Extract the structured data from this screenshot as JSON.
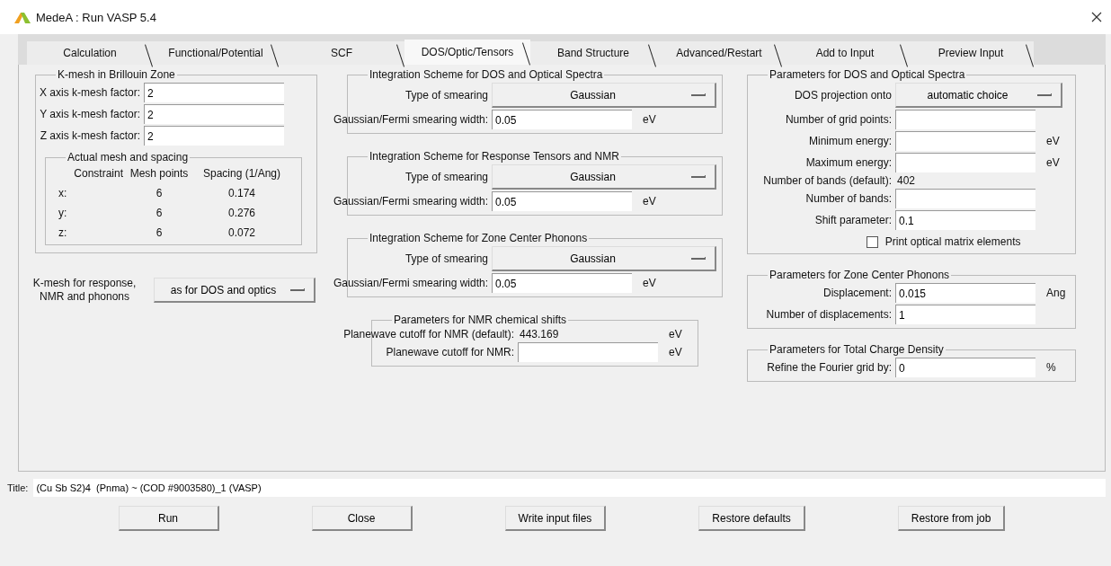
{
  "window": {
    "title": "MedeA : Run VASP 5.4"
  },
  "tabs": [
    {
      "label": "Calculation",
      "selected": false
    },
    {
      "label": "Functional/Potential",
      "selected": false
    },
    {
      "label": "SCF",
      "selected": false
    },
    {
      "label": "DOS/Optic/Tensors",
      "selected": true
    },
    {
      "label": "Band Structure",
      "selected": false
    },
    {
      "label": "Advanced/Restart",
      "selected": false
    },
    {
      "label": "Add to Input",
      "selected": false
    },
    {
      "label": "Preview Input",
      "selected": false
    }
  ],
  "kmesh": {
    "title": "K-mesh in Brillouin Zone",
    "fields": [
      {
        "label": "X axis k-mesh factor:",
        "value": "2"
      },
      {
        "label": "Y axis k-mesh factor:",
        "value": "2"
      },
      {
        "label": "Z axis k-mesh factor:",
        "value": "2"
      }
    ],
    "actual_mesh": {
      "title": "Actual mesh and spacing",
      "columns": [
        "Constraint",
        "Mesh points",
        "Spacing (1/Ang)"
      ],
      "rows": [
        [
          "x:",
          "6",
          "0.174"
        ],
        [
          "y:",
          "6",
          "0.276"
        ],
        [
          "z:",
          "6",
          "0.072"
        ]
      ]
    }
  },
  "response_kmesh": {
    "label": "K-mesh for response, NMR and phonons",
    "value": "as for DOS and optics"
  },
  "middle_groups": [
    {
      "title": "Integration Scheme for DOS and Optical Spectra",
      "rows": [
        {
          "kind": "dropdown",
          "label": "Type of smearing",
          "value": "Gaussian"
        },
        {
          "kind": "field",
          "label": "Gaussian/Fermi smearing width:",
          "value": "0.05",
          "unit": "eV"
        }
      ]
    },
    {
      "title": "Integration Scheme for Response Tensors and NMR",
      "rows": [
        {
          "kind": "dropdown",
          "label": "Type of smearing",
          "value": "Gaussian"
        },
        {
          "kind": "field",
          "label": "Gaussian/Fermi smearing width:",
          "value": "0.05",
          "unit": "eV"
        }
      ]
    },
    {
      "title": "Integration Scheme for Zone Center Phonons",
      "rows": [
        {
          "kind": "dropdown",
          "label": "Type of smearing",
          "value": "Gaussian"
        },
        {
          "kind": "field",
          "label": "Gaussian/Fermi smearing width:",
          "value": "0.05",
          "unit": "eV"
        }
      ]
    },
    {
      "title": "Parameters for NMR chemical shifts",
      "rows": [
        {
          "kind": "readout",
          "label": "Planewave cutoff for NMR (default):",
          "value": "443.169",
          "unit": "eV"
        },
        {
          "kind": "field",
          "label": "Planewave cutoff for NMR:",
          "unit": "eV"
        }
      ]
    }
  ],
  "right_groups": [
    {
      "title": "Parameters for DOS and Optical Spectra",
      "rows": [
        {
          "kind": "dropdown",
          "label": "DOS projection onto",
          "value": "automatic choice"
        },
        {
          "kind": "field",
          "label": "Number of grid points:"
        },
        {
          "kind": "field",
          "label": "Minimum energy:",
          "unit": "eV"
        },
        {
          "kind": "field",
          "label": "Maximum energy:",
          "unit": "eV"
        },
        {
          "kind": "readout",
          "label": "Number of bands (default):",
          "value": "402"
        },
        {
          "kind": "field",
          "label": "Number of bands:"
        },
        {
          "kind": "field",
          "label": "Shift parameter:",
          "value": "0.1"
        },
        {
          "kind": "checkbox",
          "label": "Print optical matrix elements",
          "checked": false
        }
      ]
    },
    {
      "title": "Parameters for Zone Center Phonons",
      "rows": [
        {
          "kind": "field",
          "label": "Displacement:",
          "value": "0.015",
          "unit": "Ang"
        },
        {
          "kind": "field",
          "label": "Number of displacements:",
          "value": "1"
        }
      ]
    },
    {
      "title": "Parameters for Total Charge Density",
      "rows": [
        {
          "kind": "field",
          "label": "Refine the Fourier grid by:",
          "value": "0",
          "unit": "%"
        }
      ]
    }
  ],
  "title_field": {
    "label": "Title:",
    "value": "(Cu Sb S2)4  (Pnma) ~ (COD #9003580)_1 (VASP)"
  },
  "buttons": [
    "Run",
    "Close",
    "Write input files",
    "Restore defaults",
    "Restore from job"
  ]
}
